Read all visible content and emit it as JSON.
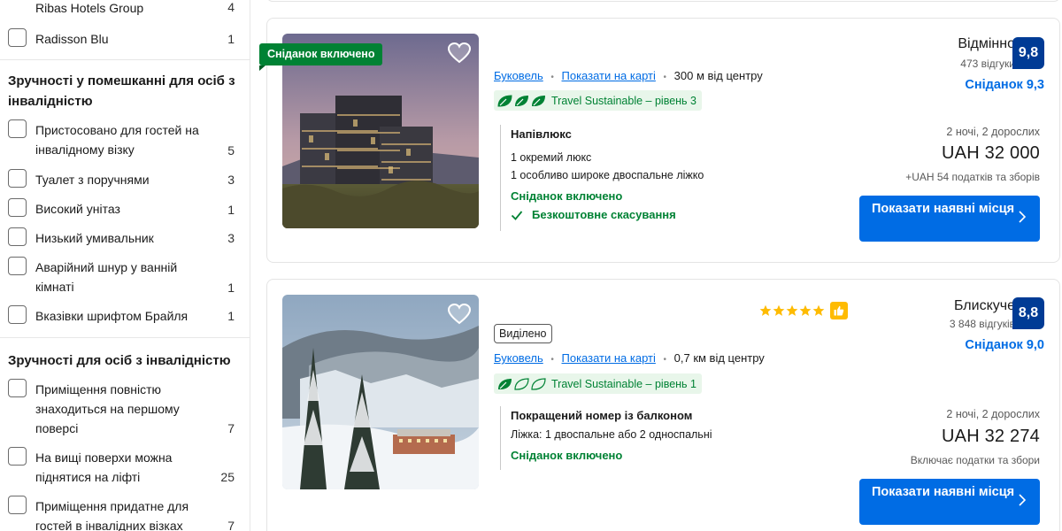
{
  "sidebar": {
    "top_items": [
      {
        "label": "Ribas Hotels Group",
        "count": "4"
      },
      {
        "label": "Radisson Blu",
        "count": "1"
      }
    ],
    "section1": {
      "title": "Зручності у помешканні для осіб з інвалідністю",
      "items": [
        {
          "label": "Пристосовано для гостей на інвалідному візку",
          "count": "5"
        },
        {
          "label": "Туалет з поручнями",
          "count": "3"
        },
        {
          "label": "Високий унітаз",
          "count": "1"
        },
        {
          "label": "Низький умивальник",
          "count": "3"
        },
        {
          "label": "Аварійний шнур у ванній кімнаті",
          "count": "1"
        },
        {
          "label": "Вказівки шрифтом Брайля",
          "count": "1"
        }
      ]
    },
    "section2": {
      "title": "Зручності для осіб з інвалідністю",
      "items": [
        {
          "label": "Приміщення повністю знаходиться на першому поверсі",
          "count": "7"
        },
        {
          "label": "На вищі поверхи можна піднятися на ліфті",
          "count": "25"
        },
        {
          "label": "Приміщення придатне для гостей в інвалідних візках",
          "count": "7"
        }
      ]
    }
  },
  "cards": [
    {
      "badge": "Сніданок включено",
      "location": "Буковель",
      "show_on_map": "Показати на карті",
      "distance": "300 м від центру",
      "sustainable": "Travel Sustainable – рівень 3",
      "sustainable_level": 3,
      "room_name": "Напівлюкс",
      "room_details": [
        "1 окремий люкс",
        "1 особливо широке двоспальне ліжко"
      ],
      "breakfast_included": "Сніданок включено",
      "free_cancellation": "Безкоштовне скасування",
      "review_word": "Відмінно",
      "review_count": "473 відгуки",
      "score": "9,8",
      "breakfast_score": "Сніданок 9,3",
      "stay_info": "2 ночі, 2 дорослих",
      "price": "UAH 32 000",
      "tax_note": "+UAH 54 податків та зборів",
      "button": "Показати наявні місця"
    },
    {
      "featured": "Виділено",
      "stars": 5,
      "location": "Буковель",
      "show_on_map": "Показати на карті",
      "distance": "0,7 км від центру",
      "sustainable": "Travel Sustainable – рівень 1",
      "sustainable_level": 1,
      "room_name": "Покращений номер із балконом",
      "room_details": [
        "Ліжка: 1 двоспальне або 2 односпальні"
      ],
      "breakfast_included": "Сніданок включено",
      "review_word": "Блискуче",
      "review_count": "3 848 відгуків",
      "score": "8,8",
      "breakfast_score": "Сніданок 9,0",
      "stay_info": "2 ночі, 2 дорослих",
      "price": "UAH 32 274",
      "tax_note": "Включає податки та збори",
      "button": "Показати наявні місця"
    }
  ],
  "colors": {
    "brand_blue": "#006ce4",
    "score_blue": "#003b95",
    "green": "#008234",
    "star_yellow": "#febb02"
  }
}
